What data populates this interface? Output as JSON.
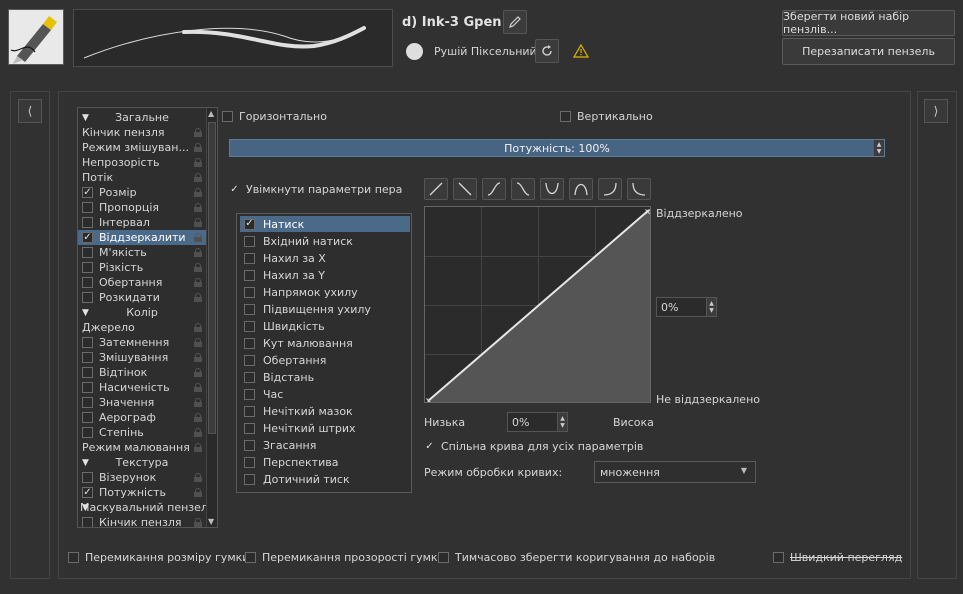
{
  "header": {
    "preset_name": "d) Ink-3 Gpen",
    "engine_name": "Рушій Піксельний",
    "save_new_label": "Зберегти новий набір пензлів...",
    "overwrite_label": "Перезаписати пензель"
  },
  "icons": {
    "edit": "pencil-icon",
    "reload": "reload-icon",
    "warning": "warning-icon",
    "left": "chevron-left-icon",
    "right": "chevron-right-icon"
  },
  "options": {
    "horizontal_label": "Горизонтально",
    "vertical_label": "Вертикально",
    "strength_label": "Потужність: 100%",
    "pen_settings_label": "Увімкнути параметри пера",
    "mirrored_label": "Віддзеркалено",
    "not_mirrored_label": "Не віддзеркалено",
    "curve_value": "0%",
    "low_label": "Низька",
    "high_label": "Висока",
    "offset_value": "0%",
    "shared_curve_label": "Спільна крива для усіх параметрів",
    "curve_mode_label": "Режим обробки кривих:",
    "curve_mode_value": "множення"
  },
  "option_list": [
    {
      "label": "Загальне",
      "type": "section"
    },
    {
      "label": "Кінчик пензля",
      "type": "item"
    },
    {
      "label": "Режим змішуван...",
      "type": "item"
    },
    {
      "label": "Непрозорість",
      "type": "item"
    },
    {
      "label": "Потік",
      "type": "item"
    },
    {
      "label": "Розмір",
      "type": "check",
      "checked": true
    },
    {
      "label": "Пропорція",
      "type": "check",
      "checked": false
    },
    {
      "label": "Інтервал",
      "type": "check",
      "checked": false
    },
    {
      "label": "Віддзеркалити",
      "type": "check",
      "checked": true,
      "selected": true
    },
    {
      "label": "М'якість",
      "type": "check",
      "checked": false
    },
    {
      "label": "Різкість",
      "type": "check",
      "checked": false
    },
    {
      "label": "Обертання",
      "type": "check",
      "checked": false
    },
    {
      "label": "Розкидати",
      "type": "check",
      "checked": false
    },
    {
      "label": "Колір",
      "type": "section"
    },
    {
      "label": "Джерело",
      "type": "item"
    },
    {
      "label": "Затемнення",
      "type": "check",
      "checked": false
    },
    {
      "label": "Змішування",
      "type": "check",
      "checked": false
    },
    {
      "label": "Відтінок",
      "type": "check",
      "checked": false
    },
    {
      "label": "Насиченість",
      "type": "check",
      "checked": false
    },
    {
      "label": "Значення",
      "type": "check",
      "checked": false
    },
    {
      "label": "Аерограф",
      "type": "check",
      "checked": false
    },
    {
      "label": "Степінь",
      "type": "check",
      "checked": false
    },
    {
      "label": "Режим малювання",
      "type": "item"
    },
    {
      "label": "Текстура",
      "type": "section"
    },
    {
      "label": "Візерунок",
      "type": "check",
      "checked": false
    },
    {
      "label": "Потужність",
      "type": "check",
      "checked": true
    },
    {
      "label": "Маскувальний пензель",
      "type": "section-left"
    },
    {
      "label": "Кінчик пензля",
      "type": "check",
      "checked": false
    }
  ],
  "sensors": [
    {
      "label": "Натиск",
      "checked": true,
      "selected": true
    },
    {
      "label": "Вхідний натиск",
      "checked": false
    },
    {
      "label": "Нахил за X",
      "checked": false
    },
    {
      "label": "Нахил за Y",
      "checked": false
    },
    {
      "label": "Напрямок ухилу",
      "checked": false
    },
    {
      "label": "Підвищення ухилу",
      "checked": false
    },
    {
      "label": "Швидкість",
      "checked": false
    },
    {
      "label": "Кут малювання",
      "checked": false
    },
    {
      "label": "Обертання",
      "checked": false
    },
    {
      "label": "Відстань",
      "checked": false
    },
    {
      "label": "Час",
      "checked": false
    },
    {
      "label": "Нечіткий мазок",
      "checked": false
    },
    {
      "label": "Нечіткий штрих",
      "checked": false
    },
    {
      "label": "Згасання",
      "checked": false
    },
    {
      "label": "Перспектива",
      "checked": false
    },
    {
      "label": "Дотичний тиск",
      "checked": false
    }
  ],
  "curve_presets": [
    "linear-curve-icon",
    "reverse-linear-curve-icon",
    "s-curve-icon",
    "reverse-s-curve-icon",
    "u-curve-icon",
    "arch-curve-icon",
    "j-curve-icon",
    "l-curve-icon"
  ],
  "footer": {
    "eraser_size_label": "Перемикання розміру гумки",
    "eraser_opacity_label": "Перемикання прозорості гумки",
    "temp_save_label": "Тимчасово зберегти коригування до наборів",
    "instant_preview_label": "Швидкий перегляд"
  }
}
